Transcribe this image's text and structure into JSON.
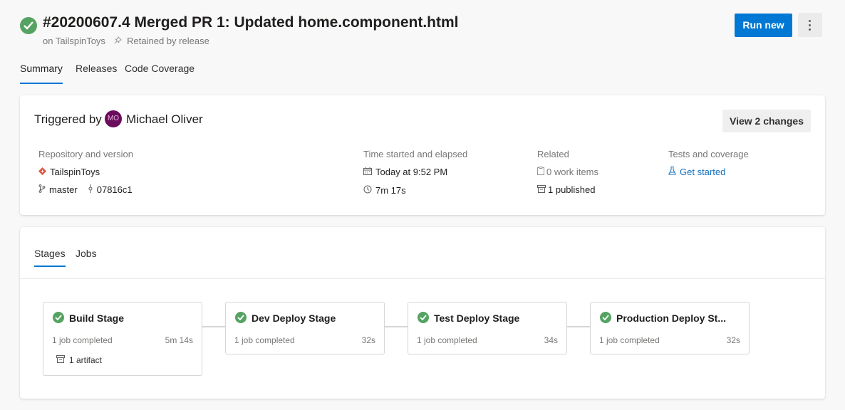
{
  "header": {
    "title": "#20200607.4 Merged PR 1: Updated home.component.html",
    "repo_text": "on TailspinToys",
    "retained_text": "Retained by release",
    "run_new_label": "Run new",
    "status_color": "#55a362",
    "more_icon": "more-vertical-icon"
  },
  "tabs": [
    {
      "label": "Summary",
      "active": true
    },
    {
      "label": "Releases",
      "active": false
    },
    {
      "label": "Code Coverage",
      "active": false
    }
  ],
  "summary": {
    "triggered_label": "Triggered by",
    "avatar_initials": "MO",
    "user_name": "Michael Oliver",
    "view_changes_label": "View 2 changes",
    "repository": {
      "heading": "Repository and version",
      "repo_name": "TailspinToys",
      "branch": "master",
      "commit": "07816c1"
    },
    "time": {
      "heading": "Time started and elapsed",
      "started": "Today at 9:52 PM",
      "elapsed": "7m 17s"
    },
    "related": {
      "heading": "Related",
      "work_items": "0 work items",
      "published": "1 published"
    },
    "tests": {
      "heading": "Tests and coverage",
      "link": "Get started"
    }
  },
  "stages_section": {
    "tabs": [
      {
        "label": "Stages",
        "active": true
      },
      {
        "label": "Jobs",
        "active": false
      }
    ],
    "stages": [
      {
        "name": "Build Stage",
        "jobs": "1 job completed",
        "duration": "5m 14s",
        "artifact": "1 artifact",
        "status": "succeeded"
      },
      {
        "name": "Dev Deploy Stage",
        "jobs": "1 job completed",
        "duration": "32s",
        "status": "succeeded"
      },
      {
        "name": "Test Deploy Stage",
        "jobs": "1 job completed",
        "duration": "34s",
        "status": "succeeded"
      },
      {
        "name": "Production Deploy St...",
        "jobs": "1 job completed",
        "duration": "32s",
        "status": "succeeded"
      }
    ]
  }
}
